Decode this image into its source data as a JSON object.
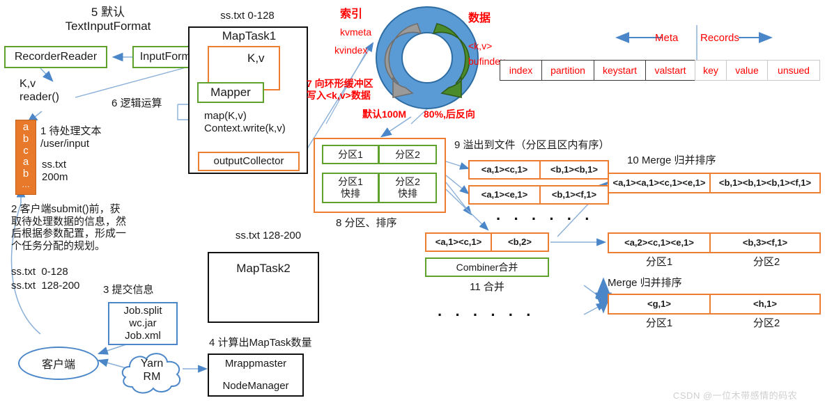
{
  "colors": {
    "green": "#5EA12C",
    "orange": "#ED7D31",
    "orange_fill": "#E8792B",
    "blue": "#4A86C8",
    "ring_blue": "#5B9BD5",
    "ring_green": "#4B8B2B",
    "ring_gray": "#9A9A9A",
    "red": "#FF0000",
    "black": "#111111"
  },
  "labels": {
    "step5": "5 默认\nTextInputFormat",
    "recorder_reader": "RecorderReader",
    "input_format": "InputFormat",
    "kv_reader": "K,v\nreader()",
    "step1": "1 待处理文本\n/user/input",
    "sstxt_200m": "ss.txt\n200m",
    "step2": "2 客户端submit()前，获\n取待处理数据的信息，然\n后根据参数配置，形成一\n个任务分配的规划。",
    "split1": "ss.txt  0-128",
    "split2": "ss.txt  128-200",
    "step3": "3 提交信息",
    "job_box": "Job.split\nwc.jar\nJob.xml",
    "client": "客户端",
    "yarn_rm": "Yarn\nRM",
    "step4": "4 计算出MapTask数量",
    "mrappmaster": "Mrappmaster",
    "nodemanager": "NodeManager",
    "maptask1_range": "ss.txt 0-128",
    "maptask1": "MapTask1",
    "kv": "K,v",
    "mapper": "Mapper",
    "step6": "6 逻辑运算",
    "map_code": "map(K,v)\nContext.write(k,v)",
    "output_collector": "outputCollector",
    "maptask2_range": "ss.txt 128-200",
    "maptask2": "MapTask2",
    "ring_index_title": "索引",
    "ring_kvmeta": "kvmeta",
    "ring_kvindex": "kvindex",
    "ring_data_title": "数据",
    "ring_kv": "<k,v>",
    "ring_bufindex": "bufindex",
    "step7": "7 向环形缓冲区\n写入<k,v>数据",
    "ring_default": "默认100M",
    "ring_pct": "80%,后反向",
    "meta_arrow_label": "Meta",
    "records_arrow_label": "Records",
    "partition1": "分区1",
    "partition2": "分区2",
    "partition1_sort": "分区1\n快排",
    "partition2_sort": "分区2\n快排",
    "step8": "8 分区、排序",
    "step9": "9 溢出到文件（分区且区内有序）",
    "step10": "10 Merge 归并排序",
    "step11": "11 合并",
    "combiner": "Combiner合并",
    "merge_sort": "Merge 归并排序",
    "dots": "· · ·   · · ·",
    "watermark": "CSDN @一位木带感情的码农"
  },
  "orange_text_block": {
    "lines": [
      "a",
      "b",
      "c",
      "a",
      "b",
      "…"
    ]
  },
  "meta_table": {
    "meta_cells": [
      {
        "label": "index",
        "width": 62
      },
      {
        "label": "partition",
        "width": 76
      },
      {
        "label": "keystart",
        "width": 76
      },
      {
        "label": "valstart",
        "width": 72
      }
    ],
    "record_cells": [
      {
        "label": "key",
        "width": 46
      },
      {
        "label": "value",
        "width": 60
      },
      {
        "label": "unsued",
        "width": 76
      }
    ]
  },
  "spill_files": [
    {
      "left": "<a,1><c,1>",
      "right": "<b,1><b,1>"
    },
    {
      "left": "<a,1><e,1>",
      "right": "<b,1><f,1>"
    }
  ],
  "merge_rows": [
    {
      "left": "<a,1><a,1><c,1><e,1>",
      "right": "<b,1><b,1><b,1><f,1>"
    }
  ],
  "combine_row": {
    "left": "<a,1><c,1>",
    "right": "<b,2>"
  },
  "result_rows": [
    {
      "left": "<a,2><c,1><e,1>",
      "right": "<b,3><f,1>"
    },
    {
      "left": "<g,1>",
      "right": "<h,1>"
    }
  ],
  "partition_labels": {
    "p1": "分区1",
    "p2": "分区2"
  }
}
